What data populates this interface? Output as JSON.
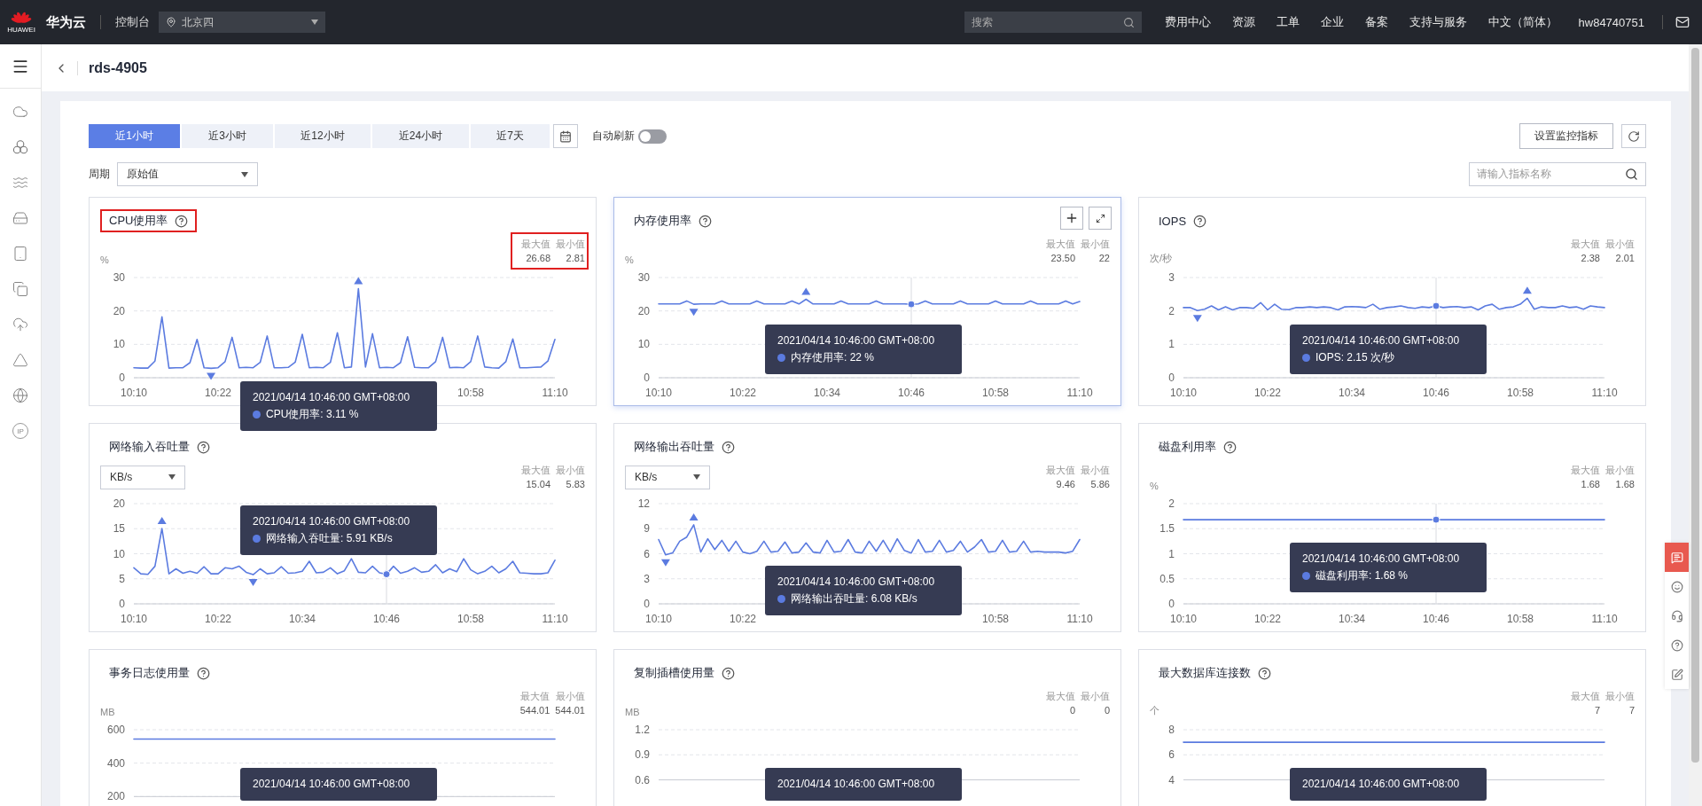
{
  "topbar": {
    "logo_text": "HUAWEI",
    "brand": "华为云",
    "console": "控制台",
    "region": "北京四",
    "search_placeholder": "搜索",
    "links": [
      "费用中心",
      "资源",
      "工单",
      "企业",
      "备案",
      "支持与服务",
      "中文（简体）",
      "hw84740751"
    ]
  },
  "sidebar": {
    "ip_label": "IP"
  },
  "header": {
    "title": "rds-4905"
  },
  "toolbar": {
    "ranges": [
      {
        "label": "近1小时",
        "selected": true
      },
      {
        "label": "近3小时",
        "selected": false
      },
      {
        "label": "近12小时",
        "selected": false
      },
      {
        "label": "近24小时",
        "selected": false
      },
      {
        "label": "近7天",
        "selected": false
      }
    ],
    "auto_refresh": {
      "label": "自动刷新",
      "on": false
    },
    "settings_button": "设置监控指标",
    "period": {
      "label": "周期",
      "value": "原始值"
    },
    "search": {
      "placeholder": "请输入指标名称"
    }
  },
  "float_tools": [
    {
      "selected": true
    },
    {
      "selected": false
    },
    {
      "selected": false
    },
    {
      "selected": false
    },
    {
      "selected": false
    }
  ],
  "metrics": [
    {
      "title": "CPU使用率",
      "title_highlighted": true,
      "stats_highlighted": true,
      "hovered": false,
      "unit": {
        "kind": "text",
        "value": "%"
      },
      "stats": [
        {
          "label": "最大值",
          "value": "26.68"
        },
        {
          "label": "最小值",
          "value": "2.81"
        }
      ],
      "tooltip": {
        "time": "2021/04/14 10:46:00 GMT+08:00",
        "label": "CPU使用率: 3.11 %"
      },
      "chart_data": {
        "type": "line",
        "grid": true,
        "ylim": [
          0,
          30
        ],
        "yticks": [
          0,
          10,
          20,
          30
        ],
        "categories": [
          "10:10",
          null,
          null,
          null,
          null,
          null,
          null,
          null,
          null,
          null,
          null,
          null,
          "10:22",
          null,
          null,
          null,
          null,
          null,
          null,
          null,
          null,
          null,
          null,
          null,
          null,
          null,
          null,
          null,
          null,
          null,
          null,
          null,
          null,
          null,
          null,
          null,
          null,
          null,
          null,
          null,
          null,
          null,
          null,
          null,
          null,
          null,
          null,
          null,
          "10:58",
          null,
          null,
          null,
          null,
          null,
          null,
          null,
          null,
          null,
          null,
          null,
          "11:10"
        ],
        "series": [
          {
            "color": "#5b7be0",
            "values": [
              3.0,
              2.9,
              2.9,
              5.0,
              18.2,
              2.9,
              3.0,
              3.0,
              4.5,
              11.5,
              3.0,
              2.81,
              3.0,
              4.8,
              12.1,
              3.0,
              3.1,
              3.0,
              4.6,
              12.5,
              3.0,
              3.0,
              3.1,
              4.7,
              13.0,
              3.0,
              3.1,
              3.0,
              4.6,
              13.5,
              3.0,
              3.2,
              26.68,
              3.2,
              13.2,
              3.0,
              3.11,
              3.0,
              4.5,
              12.3,
              3.1,
              3.0,
              3.0,
              4.8,
              12.1,
              3.0,
              3.1,
              3.0,
              4.8,
              12.5,
              3.2,
              3.0,
              2.9,
              4.8,
              11.6,
              3.0,
              3.0,
              3.1,
              3.2,
              5.0,
              11.5
            ]
          }
        ]
      }
    },
    {
      "title": "内存使用率",
      "title_highlighted": false,
      "stats_highlighted": false,
      "hovered": true,
      "unit": {
        "kind": "text",
        "value": "%"
      },
      "stats": [
        {
          "label": "最大值",
          "value": "23.50"
        },
        {
          "label": "最小值",
          "value": "22"
        }
      ],
      "tooltip": {
        "time": "2021/04/14 10:46:00 GMT+08:00",
        "label": "内存使用率: 22 %"
      },
      "chart_data": {
        "type": "line",
        "grid": true,
        "ylim": [
          0,
          30
        ],
        "yticks": [
          0,
          10,
          20,
          30
        ],
        "categories": [
          "10:10",
          null,
          null,
          null,
          null,
          null,
          null,
          null,
          null,
          null,
          null,
          null,
          "10:22",
          null,
          null,
          null,
          null,
          null,
          null,
          null,
          null,
          null,
          null,
          null,
          "10:34",
          null,
          null,
          null,
          null,
          null,
          null,
          null,
          null,
          null,
          null,
          null,
          "10:46",
          null,
          null,
          null,
          null,
          null,
          null,
          null,
          null,
          null,
          null,
          null,
          "10:58",
          null,
          null,
          null,
          null,
          null,
          null,
          null,
          null,
          null,
          null,
          null,
          "11:10"
        ],
        "annotations": [
          {
            "x": "10:46"
          }
        ],
        "series": [
          {
            "color": "#5b7be0",
            "values": [
              22.1,
              22.1,
              22.1,
              22.1,
              23.0,
              22.0,
              22.1,
              22.1,
              22.1,
              23.0,
              22.1,
              22.1,
              22.1,
              22.1,
              23.0,
              22.1,
              22.1,
              22.1,
              22.1,
              23.0,
              22.1,
              23.5,
              22.1,
              22.1,
              22.1,
              22.1,
              23.0,
              22.1,
              22.1,
              22.1,
              22.1,
              23.0,
              22.1,
              22.1,
              22.1,
              22.1,
              22.0,
              22.1,
              23.0,
              22.1,
              22.1,
              22.1,
              22.1,
              23.0,
              22.1,
              22.1,
              22.1,
              22.1,
              23.0,
              22.1,
              22.1,
              22.1,
              22.1,
              23.0,
              22.1,
              22.1,
              22.1,
              22.1,
              23.0,
              22.1,
              22.8
            ]
          }
        ]
      }
    },
    {
      "title": "IOPS",
      "title_highlighted": false,
      "stats_highlighted": false,
      "hovered": false,
      "unit": {
        "kind": "text",
        "value": "次/秒"
      },
      "stats": [
        {
          "label": "最大值",
          "value": "2.38"
        },
        {
          "label": "最小值",
          "value": "2.01"
        }
      ],
      "tooltip": {
        "time": "2021/04/14 10:46:00 GMT+08:00",
        "label": "IOPS: 2.15 次/秒"
      },
      "chart_data": {
        "type": "line",
        "grid": true,
        "ylim": [
          0,
          3
        ],
        "yticks": [
          0,
          1,
          2,
          3
        ],
        "categories": [
          "10:10",
          null,
          null,
          null,
          null,
          null,
          null,
          null,
          null,
          null,
          null,
          null,
          "10:22",
          null,
          null,
          null,
          null,
          null,
          null,
          null,
          null,
          null,
          null,
          null,
          "10:34",
          null,
          null,
          null,
          null,
          null,
          null,
          null,
          null,
          null,
          null,
          null,
          "10:46",
          null,
          null,
          null,
          null,
          null,
          null,
          null,
          null,
          null,
          null,
          null,
          "10:58",
          null,
          null,
          null,
          null,
          null,
          null,
          null,
          null,
          null,
          null,
          null,
          "11:10"
        ],
        "annotations": [
          {
            "x": "10:46"
          }
        ],
        "series": [
          {
            "color": "#5b7be0",
            "values": [
              2.1,
              2.1,
              2.01,
              2.05,
              2.15,
              2.03,
              2.12,
              2.03,
              2.1,
              2.1,
              2.08,
              2.25,
              2.03,
              2.2,
              2.05,
              2.04,
              2.1,
              2.1,
              2.12,
              2.1,
              2.12,
              2.1,
              2.03,
              2.12,
              2.13,
              2.12,
              2.1,
              2.2,
              2.05,
              2.1,
              2.12,
              2.15,
              2.1,
              2.08,
              2.12,
              2.1,
              2.15,
              2.1,
              2.12,
              2.13,
              2.1,
              2.12,
              2.03,
              2.15,
              2.2,
              2.05,
              2.1,
              2.12,
              2.2,
              2.38,
              2.05,
              2.12,
              2.1,
              2.1,
              2.15,
              2.1,
              2.12,
              2.05,
              2.15,
              2.12,
              2.1
            ]
          }
        ]
      }
    },
    {
      "title": "网络输入吞吐量",
      "title_highlighted": false,
      "stats_highlighted": false,
      "hovered": false,
      "unit": {
        "kind": "select",
        "value": "KB/s"
      },
      "stats": [
        {
          "label": "最大值",
          "value": "15.04"
        },
        {
          "label": "最小值",
          "value": "5.83"
        }
      ],
      "tooltip": {
        "time": "2021/04/14 10:46:00 GMT+08:00",
        "label": "网络输入吞吐量: 5.91 KB/s"
      },
      "chart_data": {
        "type": "line",
        "grid": true,
        "ylim": [
          0,
          20
        ],
        "yticks": [
          0,
          5,
          10,
          15,
          20
        ],
        "categories": [
          "10:10",
          null,
          null,
          null,
          null,
          null,
          null,
          null,
          null,
          null,
          null,
          null,
          "10:22",
          null,
          null,
          null,
          null,
          null,
          null,
          null,
          null,
          null,
          null,
          null,
          "10:34",
          null,
          null,
          null,
          null,
          null,
          null,
          null,
          null,
          null,
          null,
          null,
          "10:46",
          null,
          null,
          null,
          null,
          null,
          null,
          null,
          null,
          null,
          null,
          null,
          "10:58",
          null,
          null,
          null,
          null,
          null,
          null,
          null,
          null,
          null,
          null,
          null,
          "11:10"
        ],
        "annotations": [
          {
            "x": "10:46"
          }
        ],
        "series": [
          {
            "color": "#5b7be0",
            "values": [
              7.2,
              6.0,
              5.9,
              7.5,
              15.04,
              6.0,
              7.0,
              6.1,
              6.5,
              6.1,
              7.4,
              6.0,
              6.0,
              7.2,
              7.0,
              7.5,
              6.3,
              5.83,
              7.0,
              6.0,
              6.2,
              7.4,
              6.1,
              6.2,
              6.5,
              8.5,
              6.2,
              6.3,
              7.2,
              6.0,
              6.6,
              9.0,
              6.3,
              6.2,
              7.5,
              6.2,
              5.91,
              7.5,
              6.1,
              6.5,
              7.2,
              6.3,
              6.5,
              7.8,
              6.2,
              7.0,
              6.4,
              9.0,
              6.8,
              6.0,
              6.5,
              7.5,
              6.2,
              7.0,
              8.5,
              6.2,
              6.1,
              6.0,
              6.0,
              6.2,
              8.7
            ]
          }
        ]
      }
    },
    {
      "title": "网络输出吞吐量",
      "title_highlighted": false,
      "stats_highlighted": false,
      "hovered": false,
      "unit": {
        "kind": "select",
        "value": "KB/s"
      },
      "stats": [
        {
          "label": "最大值",
          "value": "9.46"
        },
        {
          "label": "最小值",
          "value": "5.86"
        }
      ],
      "tooltip": {
        "time": "2021/04/14 10:46:00 GMT+08:00",
        "label": "网络输出吞吐量: 6.08 KB/s"
      },
      "chart_data": {
        "type": "line",
        "grid": true,
        "ylim": [
          0,
          12
        ],
        "yticks": [
          0,
          3,
          6,
          9,
          12
        ],
        "categories": [
          "10:10",
          null,
          null,
          null,
          null,
          null,
          null,
          null,
          null,
          null,
          null,
          null,
          "10:22",
          null,
          null,
          null,
          null,
          null,
          null,
          null,
          null,
          null,
          null,
          null,
          null,
          null,
          null,
          null,
          null,
          null,
          null,
          null,
          null,
          null,
          null,
          null,
          null,
          null,
          null,
          null,
          null,
          null,
          null,
          null,
          null,
          null,
          null,
          null,
          "10:58",
          null,
          null,
          null,
          null,
          null,
          null,
          null,
          null,
          null,
          null,
          null,
          "11:10"
        ],
        "series": [
          {
            "color": "#5b7be0",
            "values": [
              7.7,
              5.86,
              6.1,
              7.5,
              8.0,
              9.46,
              6.2,
              7.8,
              6.5,
              7.6,
              6.3,
              7.5,
              6.2,
              6.0,
              6.3,
              7.5,
              6.2,
              6.3,
              7.4,
              6.1,
              6.2,
              7.3,
              6.2,
              6.1,
              7.6,
              6.2,
              6.3,
              7.7,
              6.2,
              6.1,
              7.5,
              6.3,
              7.6,
              6.2,
              7.8,
              6.4,
              6.08,
              7.7,
              6.2,
              6.3,
              7.6,
              6.2,
              6.4,
              7.5,
              6.2,
              6.8,
              7.7,
              6.2,
              6.3,
              7.6,
              6.2,
              6.3,
              7.5,
              6.2,
              6.3,
              6.2,
              6.2,
              6.2,
              6.1,
              6.3,
              7.7
            ]
          }
        ]
      }
    },
    {
      "title": "磁盘利用率",
      "title_highlighted": false,
      "stats_highlighted": false,
      "hovered": false,
      "unit": {
        "kind": "text",
        "value": "%"
      },
      "stats": [
        {
          "label": "最大值",
          "value": "1.68"
        },
        {
          "label": "最小值",
          "value": "1.68"
        }
      ],
      "tooltip": {
        "time": "2021/04/14 10:46:00 GMT+08:00",
        "label": "磁盘利用率: 1.68 %"
      },
      "chart_data": {
        "type": "line",
        "grid": true,
        "ylim": [
          0,
          2
        ],
        "yticks": [
          0,
          0.5,
          1,
          1.5,
          2
        ],
        "categories": [
          "10:10",
          null,
          null,
          null,
          null,
          null,
          null,
          null,
          null,
          null,
          null,
          null,
          "10:22",
          null,
          null,
          null,
          null,
          null,
          null,
          null,
          null,
          null,
          null,
          null,
          "10:34",
          null,
          null,
          null,
          null,
          null,
          null,
          null,
          null,
          null,
          null,
          null,
          "10:46",
          null,
          null,
          null,
          null,
          null,
          null,
          null,
          null,
          null,
          null,
          null,
          "10:58",
          null,
          null,
          null,
          null,
          null,
          null,
          null,
          null,
          null,
          null,
          null,
          "11:10"
        ],
        "annotations": [
          {
            "x": "10:46"
          }
        ],
        "series": [
          {
            "color": "#5b7be0",
            "values": [
              1.68,
              1.68,
              1.68,
              1.68,
              1.68,
              1.68,
              1.68,
              1.68,
              1.68,
              1.68,
              1.68,
              1.68,
              1.68,
              1.68,
              1.68,
              1.68,
              1.68,
              1.68,
              1.68,
              1.68,
              1.68,
              1.68,
              1.68,
              1.68,
              1.68,
              1.68,
              1.68,
              1.68,
              1.68,
              1.68,
              1.68,
              1.68,
              1.68,
              1.68,
              1.68,
              1.68,
              1.68,
              1.68,
              1.68,
              1.68,
              1.68,
              1.68,
              1.68,
              1.68,
              1.68,
              1.68,
              1.68,
              1.68,
              1.68,
              1.68,
              1.68,
              1.68,
              1.68,
              1.68,
              1.68,
              1.68,
              1.68,
              1.68,
              1.68,
              1.68,
              1.68
            ]
          }
        ]
      }
    },
    {
      "title": "事务日志使用量",
      "title_highlighted": false,
      "stats_highlighted": false,
      "hovered": false,
      "unit": {
        "kind": "text",
        "value": "MB"
      },
      "stats": [
        {
          "label": "最大值",
          "value": "544.01"
        },
        {
          "label": "最小值",
          "value": "544.01"
        }
      ],
      "tooltip": {
        "time": "2021/04/14 10:46:00 GMT+08:00"
      },
      "chart_data": {
        "type": "line",
        "grid": true,
        "ylim": [
          200,
          600
        ],
        "yticks": [
          200,
          400,
          600
        ],
        "categories": [
          null,
          null,
          null,
          null,
          null,
          null,
          null,
          null,
          null,
          null,
          null,
          null,
          null,
          null,
          null,
          null,
          null,
          null,
          null,
          null,
          null,
          null,
          null,
          null,
          null,
          null,
          null,
          null,
          null,
          null,
          null,
          null,
          null,
          null,
          null,
          null,
          null,
          null,
          null,
          null,
          null,
          null,
          null,
          null,
          null,
          null,
          null,
          null,
          null,
          null,
          null,
          null,
          null,
          null,
          null,
          null,
          null,
          null,
          null,
          null,
          null
        ],
        "series": [
          {
            "color": "#5b7be0",
            "values": [
              544.01,
              544.01,
              544.01,
              544.01,
              544.01,
              544.01,
              544.01,
              544.01,
              544.01,
              544.01,
              544.01,
              544.01,
              544.01,
              544.01,
              544.01,
              544.01,
              544.01,
              544.01,
              544.01,
              544.01,
              544.01,
              544.01,
              544.01,
              544.01,
              544.01,
              544.01,
              544.01,
              544.01,
              544.01,
              544.01,
              544.01,
              544.01,
              544.01,
              544.01,
              544.01,
              544.01,
              544.01,
              544.01,
              544.01,
              544.01,
              544.01,
              544.01,
              544.01,
              544.01,
              544.01,
              544.01,
              544.01,
              544.01,
              544.01,
              544.01,
              544.01,
              544.01,
              544.01,
              544.01,
              544.01,
              544.01,
              544.01,
              544.01,
              544.01,
              544.01,
              544.01
            ]
          }
        ]
      }
    },
    {
      "title": "复制插槽使用量",
      "title_highlighted": false,
      "stats_highlighted": false,
      "hovered": false,
      "unit": {
        "kind": "text",
        "value": "MB"
      },
      "stats": [
        {
          "label": "最大值",
          "value": "0"
        },
        {
          "label": "最小值",
          "value": "0"
        }
      ],
      "tooltip": {
        "time": "2021/04/14 10:46:00 GMT+08:00"
      },
      "chart_data": {
        "type": "line",
        "grid": true,
        "ylim": [
          0.6,
          1.2
        ],
        "yticks": [
          0.6,
          0.9,
          1.2
        ],
        "categories": [
          null,
          null
        ],
        "series": [
          {
            "color": "#5b7be0",
            "values": [
              null,
              null
            ]
          }
        ]
      }
    },
    {
      "title": "最大数据库连接数",
      "title_highlighted": false,
      "stats_highlighted": false,
      "hovered": false,
      "unit": {
        "kind": "text",
        "value": "个"
      },
      "stats": [
        {
          "label": "最大值",
          "value": "7"
        },
        {
          "label": "最小值",
          "value": "7"
        }
      ],
      "tooltip": {
        "time": "2021/04/14 10:46:00 GMT+08:00"
      },
      "chart_data": {
        "type": "line",
        "grid": true,
        "ylim": [
          4,
          8
        ],
        "yticks": [
          4,
          6,
          8
        ],
        "categories": [
          null,
          null,
          null,
          null,
          null,
          null,
          null,
          null,
          null,
          null,
          null,
          null,
          null,
          null,
          null,
          null,
          null,
          null,
          null,
          null,
          null,
          null,
          null,
          null,
          null,
          null,
          null,
          null,
          null,
          null,
          null,
          null,
          null,
          null,
          null,
          null,
          null,
          null,
          null,
          null,
          null,
          null,
          null,
          null,
          null,
          null,
          null,
          null,
          null,
          null,
          null,
          null,
          null,
          null,
          null,
          null,
          null,
          null,
          null,
          null,
          null
        ],
        "series": [
          {
            "color": "#5b7be0",
            "values": [
              7,
              7,
              7,
              7,
              7,
              7,
              7,
              7,
              7,
              7,
              7,
              7,
              7,
              7,
              7,
              7,
              7,
              7,
              7,
              7,
              7,
              7,
              7,
              7,
              7,
              7,
              7,
              7,
              7,
              7,
              7,
              7,
              7,
              7,
              7,
              7,
              7,
              7,
              7,
              7,
              7,
              7,
              7,
              7,
              7,
              7,
              7,
              7,
              7,
              7,
              7,
              7,
              7,
              7,
              7,
              7,
              7,
              7,
              7,
              7,
              7
            ]
          }
        ]
      }
    }
  ]
}
